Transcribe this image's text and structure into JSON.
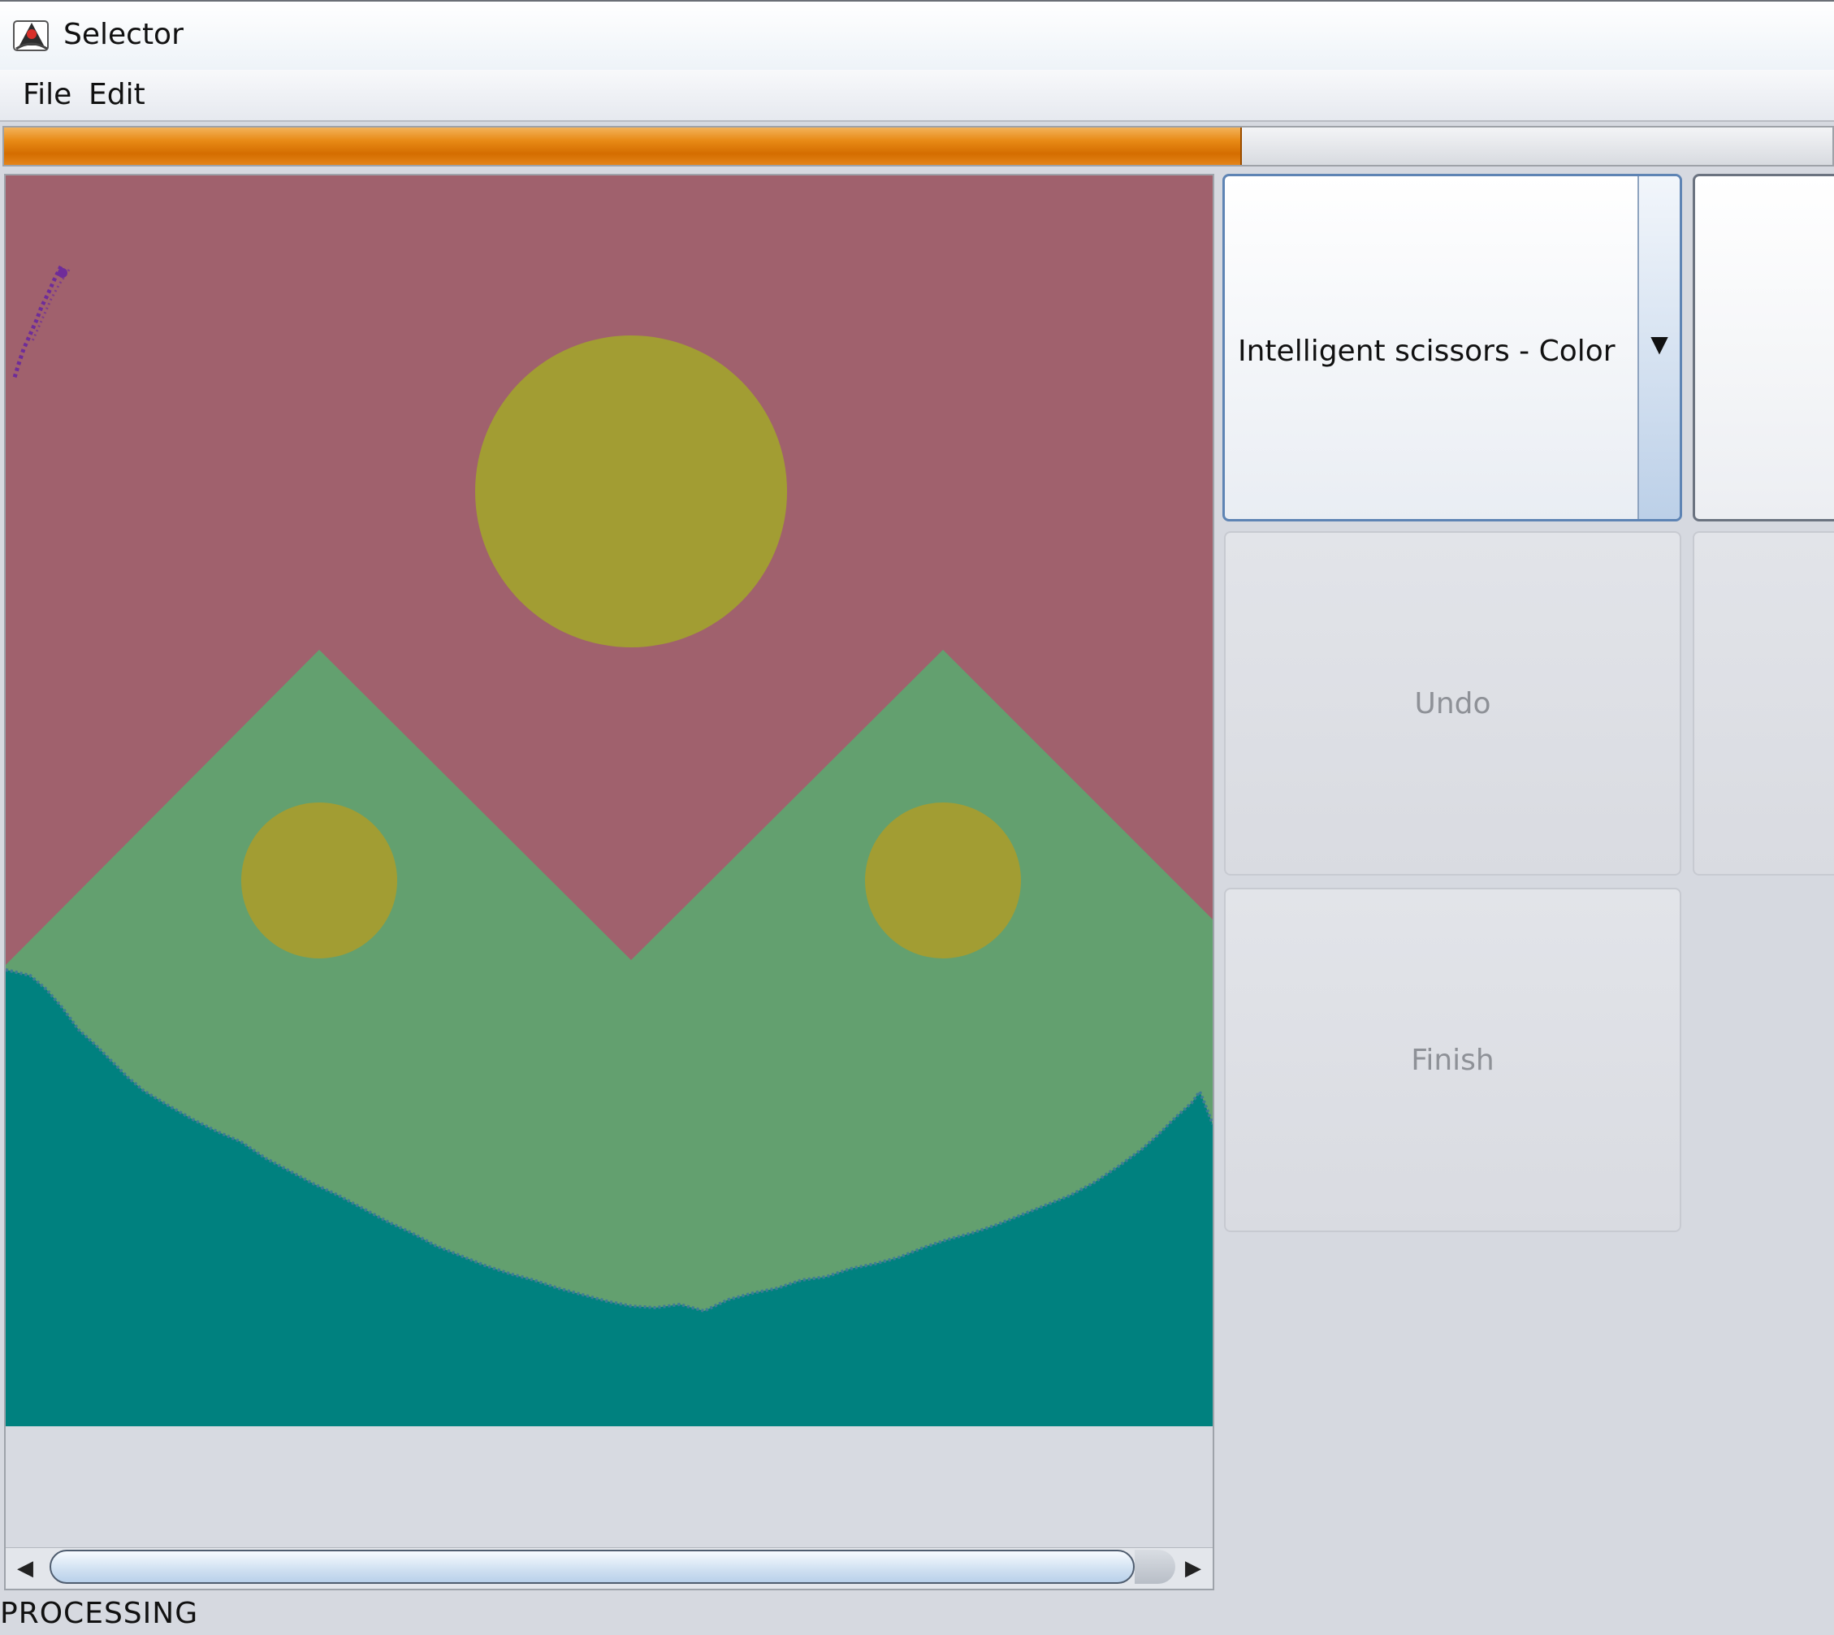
{
  "window": {
    "title": "Selector"
  },
  "menu": {
    "items": [
      "File",
      "Edit"
    ]
  },
  "progress": {
    "fraction": 0.676
  },
  "tool_select": {
    "selected": "Intelligent scissors - Color"
  },
  "buttons": {
    "undo": "Undo",
    "finish": "Finish"
  },
  "status": {
    "text": "PROCESSING"
  },
  "colors": {
    "sky": "#a0616d",
    "sun": "#a29d33",
    "mountains": "#63a06f",
    "sea": "#00817f",
    "progress": "#e88a16",
    "selection_path": "#6f2c9a"
  }
}
